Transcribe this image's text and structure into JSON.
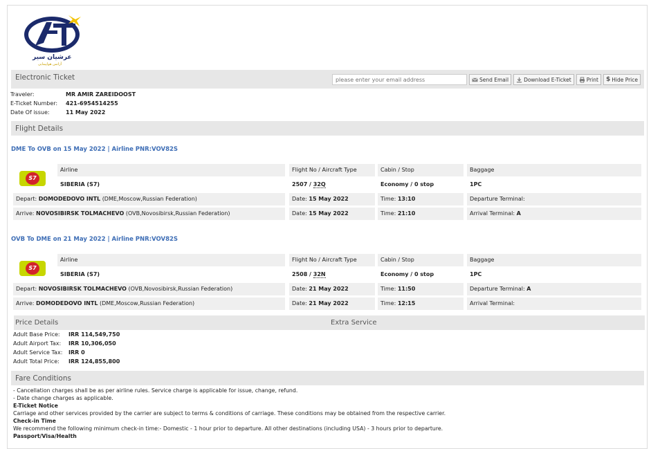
{
  "brand": {
    "name_fa": "عرشیان سیر",
    "tagline_fa": "آژانس هواپیمایی",
    "logo_colors": [
      "#1b2a6b",
      "#f2c200"
    ]
  },
  "toolbar": {
    "title": "Electronic Ticket",
    "email_placeholder": "please enter your email address",
    "send_email": "Send Email",
    "download": "Download E-Ticket",
    "print": "Print",
    "hide_price": "Hide Price"
  },
  "traveler": {
    "traveler_label": "Traveler:",
    "traveler_value": "MR AMIR ZAREIDOOST",
    "ticket_label": "E-Ticket Number:",
    "ticket_value": "421-6954514255",
    "issue_label": "Date Of issue:",
    "issue_value": "11 May 2022"
  },
  "flight_details_title": "Flight Details",
  "headers": {
    "airline": "Airline",
    "flight_no": "Flight No / Aircraft Type",
    "cabin": "Cabin / Stop",
    "baggage": "Baggage"
  },
  "flights": [
    {
      "heading": "DME To OVB on 15 May 2022 | Airline PNR:VOV82S",
      "airline": "SIBERIA (S7)",
      "flight_no": "2507 / ",
      "aircraft": "32Q",
      "cabin": "Economy / 0 stop",
      "baggage": "1PC",
      "depart_label": "Depart:",
      "depart_airport": "DOMODEDOVO INTL",
      "depart_city": "(DME,Moscow,Russian Federation)",
      "depart_date_label": "Date:",
      "depart_date": "15 May 2022",
      "depart_time_label": "Time:",
      "depart_time": "13:10",
      "depart_terminal_label": "Departure Terminal:",
      "depart_terminal": "",
      "arrive_label": "Arrive:",
      "arrive_airport": "NOVOSIBIRSK TOLMACHEVO",
      "arrive_city": "(OVB,Novosibirsk,Russian Federation)",
      "arrive_date_label": "Date:",
      "arrive_date": "15 May 2022",
      "arrive_time_label": "Time:",
      "arrive_time": "21:10",
      "arrive_terminal_label": "Arrival Terminal:",
      "arrive_terminal": "A"
    },
    {
      "heading": "OVB To DME on 21 May 2022 | Airline PNR:VOV82S",
      "airline": "SIBERIA (S7)",
      "flight_no": "2508 / ",
      "aircraft": "32N",
      "cabin": "Economy / 0 stop",
      "baggage": "1PC",
      "depart_label": "Depart:",
      "depart_airport": "NOVOSIBIRSK TOLMACHEVO",
      "depart_city": "(OVB,Novosibirsk,Russian Federation)",
      "depart_date_label": "Date:",
      "depart_date": "21 May 2022",
      "depart_time_label": "Time:",
      "depart_time": "11:50",
      "depart_terminal_label": "Departure Terminal:",
      "depart_terminal": "A",
      "arrive_label": "Arrive:",
      "arrive_airport": "DOMODEDOVO INTL",
      "arrive_city": "(DME,Moscow,Russian Federation)",
      "arrive_date_label": "Date:",
      "arrive_date": "21 May 2022",
      "arrive_time_label": "Time:",
      "arrive_time": "12:15",
      "arrive_terminal_label": "Arrival Terminal:",
      "arrive_terminal": ""
    }
  ],
  "price": {
    "title": "Price Details",
    "extra_title": "Extra Service",
    "base_label": "Adult Base Price:",
    "base_value": "IRR 114,549,750",
    "airport_label": "Adult Airport Tax:",
    "airport_value": "IRR 10,306,050",
    "service_label": "Adult Service Tax:",
    "service_value": "IRR 0",
    "total_label": "Adult Total Price:",
    "total_value": "IRR 124,855,800"
  },
  "fare": {
    "title": "Fare Conditions",
    "line1": "- Cancellation charges shall be as per airline rules. Service charge is applicable for issue, change, refund.",
    "line2": "- Date change charges as applicable.",
    "eticket_title": "E-Ticket Notice",
    "eticket_text": "Carriage and other services provided by the carrier are subject to terms & conditions of carriage. These conditions may be obtained from the respective carrier.",
    "checkin_title": "Check-in Time",
    "checkin_text": "We recommend the following minimum check-in time:- Domestic - 1 hour prior to departure. All other destinations (including USA) - 3 hours prior to departure.",
    "passport_title": "Passport/Visa/Health"
  }
}
